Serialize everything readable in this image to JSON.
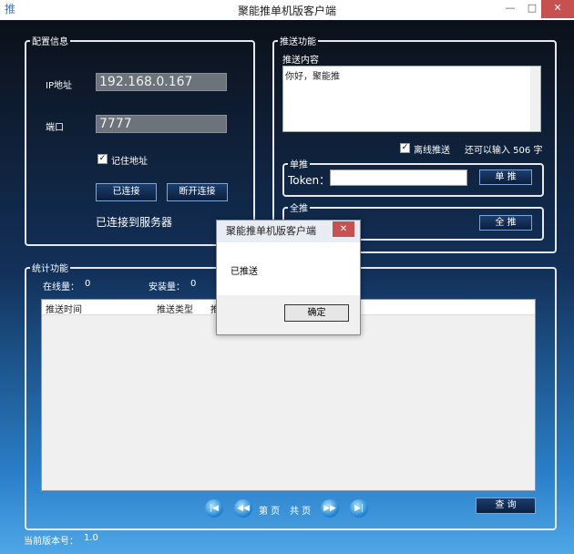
{
  "window": {
    "title": "聚能推单机版客户端",
    "minimize": "—",
    "maximize": "□",
    "close": "✕",
    "logo": "推"
  },
  "config": {
    "legend": "配置信息",
    "ip_label": "IP地址",
    "ip_value": "192.168.0.167",
    "port_label": "端口",
    "port_value": "7777",
    "remember_checked": "✓",
    "remember_label": "记住地址",
    "connect_button": "已连接",
    "disconnect_button": "断开连接",
    "status": "已连接到服务器"
  },
  "push": {
    "legend": "推送功能",
    "content_label": "推送内容",
    "content_value": "你好，聚能推",
    "offline_checked": "✓",
    "offline_label": "离线推送",
    "remaining": "还可以输入 506 字",
    "single_legend": "单推",
    "token_label": "Token：",
    "token_value": "",
    "single_button": "单 推",
    "all_legend": "全推",
    "all_button": "全 推"
  },
  "stats": {
    "legend": "统计功能",
    "online_label": "在线量：",
    "online_value": "0",
    "install_label": "安装量：",
    "install_value": "0",
    "columns": [
      "推送时间",
      "推送类型",
      "推"
    ],
    "pager": {
      "page_label": "第 页",
      "total_label": "共 页"
    },
    "query_button": "查 询"
  },
  "footer": {
    "version_label": "当前版本号：",
    "version_value": "1.0"
  },
  "dialog": {
    "title": "聚能推单机版客户端",
    "message": "已推送",
    "ok_button": "确定",
    "close": "✕"
  },
  "icons": {
    "first_page": "first-page-icon",
    "prev_page": "prev-page-icon",
    "next_page": "next-page-icon",
    "last_page": "last-page-icon"
  }
}
